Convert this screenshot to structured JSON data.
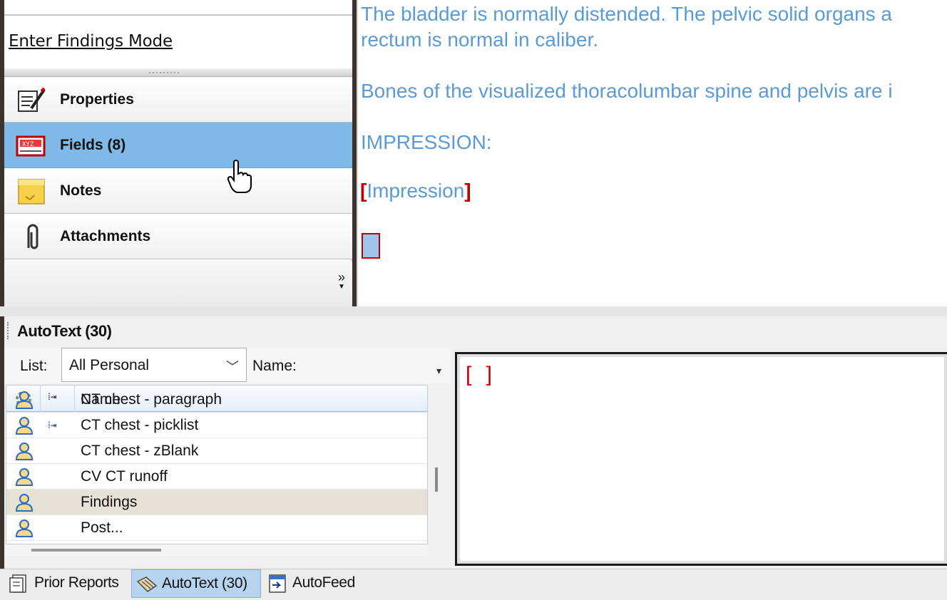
{
  "findings_panel": {
    "enter_findings_link": "Enter Findings Mode"
  },
  "nav": {
    "items": [
      {
        "label": "Properties",
        "icon": "properties-icon"
      },
      {
        "label": "Fields (8)",
        "icon": "fields-icon",
        "active": true
      },
      {
        "label": "Notes",
        "icon": "notes-icon"
      },
      {
        "label": "Attachments",
        "icon": "paperclip-icon"
      }
    ],
    "overflow_glyph": "»"
  },
  "report": {
    "lines": [
      "The bladder is normally distended. The pelvic solid organs a",
      "rectum is normal in caliber.",
      "Bones of the visualized thoracolumbar spine and pelvis are i",
      "IMPRESSION:"
    ],
    "impression_field": {
      "open_bracket": "[",
      "text": "Impression",
      "close_bracket": "]"
    }
  },
  "autotext": {
    "title": "AutoText (30)",
    "filter": {
      "list_label": "List:",
      "list_value": "All Personal",
      "name_label": "Name:"
    },
    "grid": {
      "header_name": "Name",
      "rows": [
        {
          "name": "CT chest - paragraph",
          "insert": false,
          "selected": false
        },
        {
          "name": "CT chest - picklist",
          "insert": true,
          "selected": false
        },
        {
          "name": "CT chest - zBlank",
          "insert": false,
          "selected": false
        },
        {
          "name": "CV CT runoff",
          "insert": false,
          "selected": false
        },
        {
          "name": "Findings",
          "insert": false,
          "selected": true
        },
        {
          "name": "Post...",
          "insert": false,
          "selected": false
        }
      ]
    },
    "preview_text": "[ ]"
  },
  "bottom_tabs": [
    {
      "label": "Prior Reports",
      "icon": "report-icon",
      "active": false
    },
    {
      "label": "AutoText (30)",
      "icon": "autotext-icon",
      "active": true
    },
    {
      "label": "AutoFeed",
      "icon": "autofeed-icon",
      "active": false
    }
  ],
  "colors": {
    "report_text": "#5b9bd5",
    "field_bracket": "#c00000",
    "active_nav": "#7fb9e8",
    "selected_row": "#e6e2d8"
  }
}
